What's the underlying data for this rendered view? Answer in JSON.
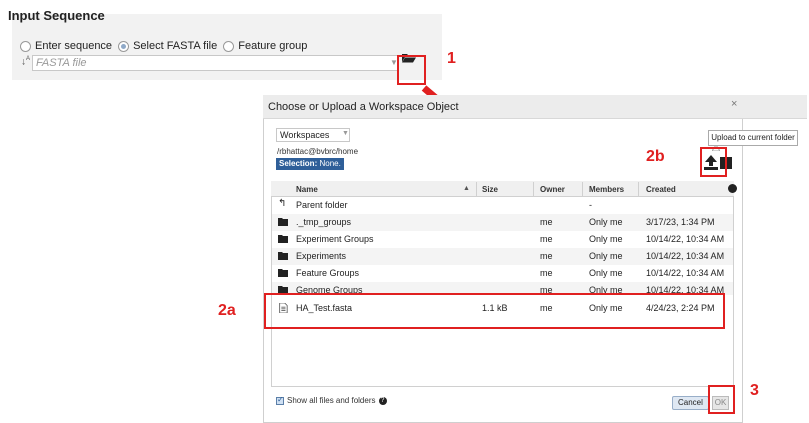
{
  "input_sequence": {
    "title": "Input Sequence",
    "options": [
      {
        "label": "Enter sequence",
        "selected": false
      },
      {
        "label": "Select FASTA file",
        "selected": true
      },
      {
        "label": "Feature group",
        "selected": false
      }
    ],
    "fasta_placeholder": "FASTA file"
  },
  "annotations": {
    "step1": "1",
    "step2a": "2a",
    "step2b": "2b",
    "step3": "3",
    "color": "#e02020"
  },
  "dialog": {
    "title": "Choose or Upload a Workspace Object",
    "close": "×",
    "workspace_select": "Workspaces",
    "path": "/rbhattac@bvbrc/home",
    "selection_label": "Selection:",
    "selection_value": "None.",
    "upload_tooltip": "Upload to current folder",
    "columns": [
      "Name",
      "Size",
      "Owner",
      "Members",
      "Created"
    ],
    "rows": [
      {
        "icon": "parent-folder-icon",
        "name": "Parent folder",
        "size": "",
        "owner": "",
        "members": "-",
        "created": ""
      },
      {
        "icon": "folder-icon",
        "name": "._tmp_groups",
        "size": "",
        "owner": "me",
        "members": "Only me",
        "created": "3/17/23, 1:34 PM"
      },
      {
        "icon": "folder-icon",
        "name": "Experiment Groups",
        "size": "",
        "owner": "me",
        "members": "Only me",
        "created": "10/14/22, 10:34 AM"
      },
      {
        "icon": "folder-icon",
        "name": "Experiments",
        "size": "",
        "owner": "me",
        "members": "Only me",
        "created": "10/14/22, 10:34 AM"
      },
      {
        "icon": "folder-icon",
        "name": "Feature Groups",
        "size": "",
        "owner": "me",
        "members": "Only me",
        "created": "10/14/22, 10:34 AM"
      },
      {
        "icon": "folder-icon",
        "name": "Genome Groups",
        "size": "",
        "owner": "me",
        "members": "Only me",
        "created": "10/14/22, 10:34 AM"
      },
      {
        "icon": "file-icon",
        "name": "HA_Test.fasta",
        "size": "1.1 kB",
        "owner": "me",
        "members": "Only me",
        "created": "4/24/23, 2:24 PM"
      }
    ],
    "show_all_label": "Show all files and folders",
    "cancel_label": "Cancel",
    "ok_label": "OK"
  }
}
